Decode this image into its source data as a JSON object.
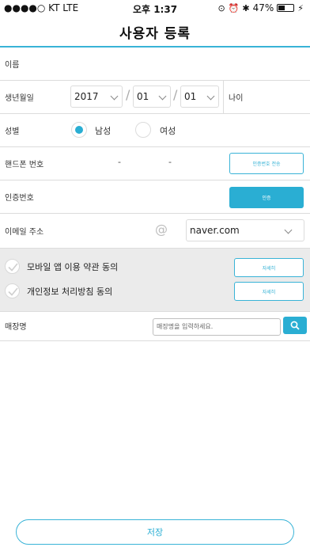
{
  "status_bar": {
    "carrier": "●●●●○ KT  LTE",
    "time": "오후 1:37",
    "battery_percent": "47%",
    "battery_level": 0.47
  },
  "nav": {
    "title": "사용자 등록"
  },
  "form": {
    "name_label": "이름",
    "birth_label": "생년월일",
    "birth_year": "2017",
    "birth_month": "01",
    "birth_day": "01",
    "date_separator": "/",
    "age_label": "나이",
    "gender_label": "성별",
    "gender_male": "남성",
    "gender_female": "여성",
    "gender_selected": "남성",
    "phone_label": "핸드폰 번호",
    "phone_separator": "-",
    "send_code_label": "인증번호 전송",
    "code_label": "인증번호",
    "verify_label": "인증",
    "email_label": "이메일 주소",
    "email_at": "@",
    "email_domain": "naver.com"
  },
  "agreements": [
    {
      "label": "모바일 앱 이용 약관 동의",
      "button": "자세히"
    },
    {
      "label": "개인정보 처리방침 동의",
      "button": "자세히"
    }
  ],
  "store": {
    "label": "매장명",
    "placeholder": "매장명을 입력하세요."
  },
  "save_label": "저장",
  "colors": {
    "accent": "#2aaed3",
    "divider": "#dcdcdc",
    "agree_bg": "#ebebeb"
  },
  "icons": [
    "signal-icon",
    "alarm-icon",
    "bluetooth-icon",
    "battery-icon",
    "chevron-down-icon",
    "at-icon",
    "check-icon",
    "search-icon"
  ]
}
